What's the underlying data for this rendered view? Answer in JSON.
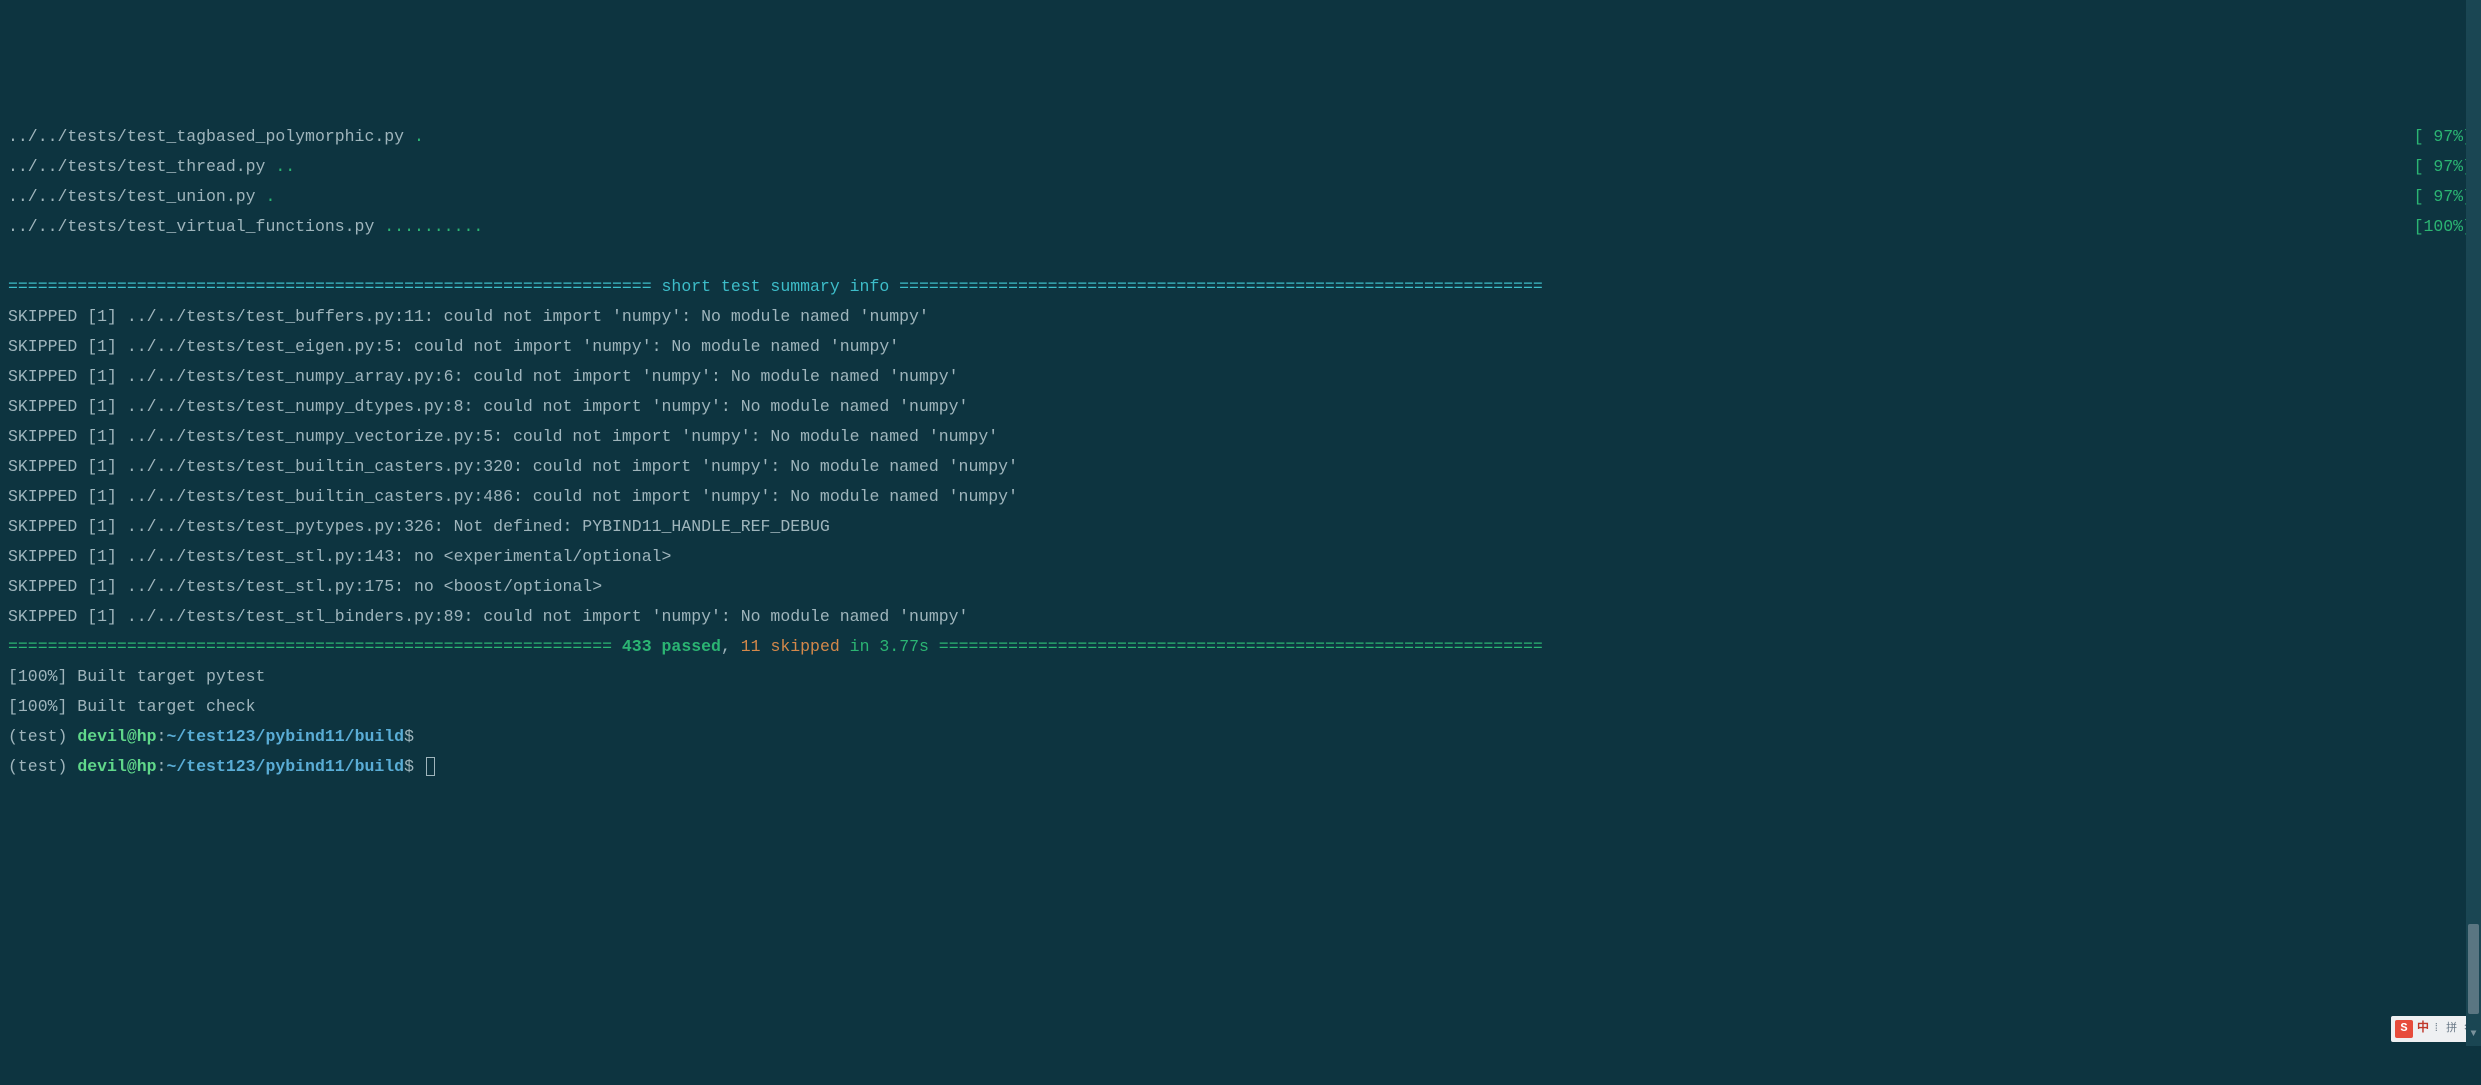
{
  "test_lines": [
    {
      "path": "../../tests/test_tagbased_polymorphic.py ",
      "dots": ".",
      "pct": "[ 97%]"
    },
    {
      "path": "../../tests/test_thread.py ",
      "dots": "..",
      "pct": "[ 97%]"
    },
    {
      "path": "../../tests/test_union.py ",
      "dots": ".",
      "pct": "[ 97%]"
    },
    {
      "path": "../../tests/test_virtual_functions.py ",
      "dots": "..........",
      "pct": "[100%]"
    }
  ],
  "summary_header": " short test summary info ",
  "skipped": [
    "SKIPPED [1] ../../tests/test_buffers.py:11: could not import 'numpy': No module named 'numpy'",
    "SKIPPED [1] ../../tests/test_eigen.py:5: could not import 'numpy': No module named 'numpy'",
    "SKIPPED [1] ../../tests/test_numpy_array.py:6: could not import 'numpy': No module named 'numpy'",
    "SKIPPED [1] ../../tests/test_numpy_dtypes.py:8: could not import 'numpy': No module named 'numpy'",
    "SKIPPED [1] ../../tests/test_numpy_vectorize.py:5: could not import 'numpy': No module named 'numpy'",
    "SKIPPED [1] ../../tests/test_builtin_casters.py:320: could not import 'numpy': No module named 'numpy'",
    "SKIPPED [1] ../../tests/test_builtin_casters.py:486: could not import 'numpy': No module named 'numpy'",
    "SKIPPED [1] ../../tests/test_pytypes.py:326: Not defined: PYBIND11_HANDLE_REF_DEBUG",
    "SKIPPED [1] ../../tests/test_stl.py:143: no <experimental/optional>",
    "SKIPPED [1] ../../tests/test_stl.py:175: no <boost/optional>",
    "SKIPPED [1] ../../tests/test_stl_binders.py:89: could not import 'numpy': No module named 'numpy'"
  ],
  "result": {
    "passed": "433 passed",
    "comma": ", ",
    "skipped": "11 skipped",
    "in": " in ",
    "time": "3.77s"
  },
  "build": [
    "[100%] Built target pytest",
    "[100%] Built target check"
  ],
  "prompt": {
    "env": "(test) ",
    "user": "devil@hp",
    "colon": ":",
    "path": "~/test123/pybind11/build",
    "dollar": "$"
  },
  "ime": {
    "s": "S",
    "zh": "中",
    "rest": "⁞ 拼 ✲"
  }
}
